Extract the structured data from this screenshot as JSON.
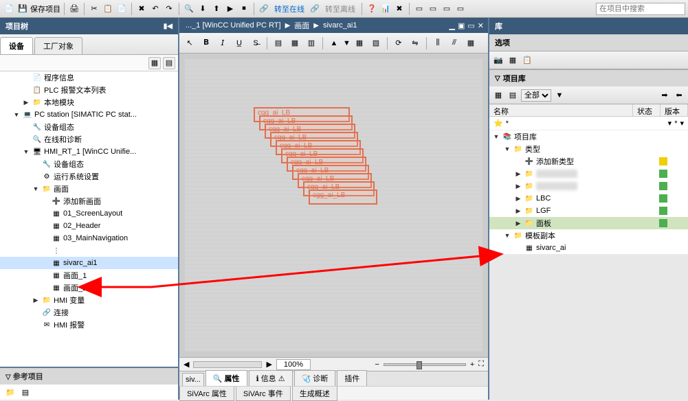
{
  "toolbar": {
    "save_project": "保存项目",
    "goto_online": "转至在线",
    "goto_offline": "转至离线",
    "search_placeholder": "在项目中搜索"
  },
  "left": {
    "title": "项目树",
    "tab_devices": "设备",
    "tab_plant": "工厂对象",
    "ref_title": "参考项目",
    "tree": [
      {
        "ind": 2,
        "arr": "",
        "ico": "📄",
        "label": "程序信息"
      },
      {
        "ind": 2,
        "arr": "",
        "ico": "📋",
        "label": "PLC 报警文本列表"
      },
      {
        "ind": 2,
        "arr": "▶",
        "ico": "📁",
        "label": "本地模块"
      },
      {
        "ind": 1,
        "arr": "▼",
        "ico": "💻",
        "label": "PC station [SIMATIC PC stat..."
      },
      {
        "ind": 2,
        "arr": "",
        "ico": "🔧",
        "label": "设备组态"
      },
      {
        "ind": 2,
        "arr": "",
        "ico": "🔍",
        "label": "在线和诊断"
      },
      {
        "ind": 2,
        "arr": "▼",
        "ico": "🖥",
        "label": "HMI_RT_1 [WinCC Unifie..."
      },
      {
        "ind": 3,
        "arr": "",
        "ico": "🔧",
        "label": "设备组态"
      },
      {
        "ind": 3,
        "arr": "",
        "ico": "⚙",
        "label": "运行系统设置"
      },
      {
        "ind": 3,
        "arr": "▼",
        "ico": "📁",
        "label": "画面"
      },
      {
        "ind": 4,
        "arr": "",
        "ico": "➕",
        "label": "添加新画面"
      },
      {
        "ind": 4,
        "arr": "",
        "ico": "▦",
        "label": "01_ScreenLayout"
      },
      {
        "ind": 4,
        "arr": "",
        "ico": "▦",
        "label": "02_Header"
      },
      {
        "ind": 4,
        "arr": "",
        "ico": "▦",
        "label": "03_MainNavigation"
      },
      {
        "ind": 4,
        "arr": "",
        "ico": "⋮",
        "label": ""
      },
      {
        "ind": 4,
        "arr": "",
        "ico": "▦",
        "label": "sivarc_ai1",
        "sel": true
      },
      {
        "ind": 4,
        "arr": "",
        "ico": "▦",
        "label": "画面_1"
      },
      {
        "ind": 4,
        "arr": "",
        "ico": "▦",
        "label": "画面_2"
      },
      {
        "ind": 3,
        "arr": "▶",
        "ico": "📁",
        "label": "HMI 变量"
      },
      {
        "ind": 3,
        "arr": "",
        "ico": "🔗",
        "label": "连接"
      },
      {
        "ind": 3,
        "arr": "",
        "ico": "✉",
        "label": "HMI 报警"
      }
    ]
  },
  "center": {
    "crumb1": "..._1 [WinCC Unified PC RT]",
    "crumb2": "画面",
    "crumb3": "sivarc_ai1",
    "zoom": "100%",
    "fp_label": "cgg_ai_LB",
    "bottom_tabs": {
      "siv": "siv...",
      "prop": "属性",
      "info": "信息",
      "diag": "诊断",
      "plugin": "插件"
    },
    "sivarc_tabs": {
      "attr": "SiVArc 属性",
      "event": "SiVArc 事件",
      "gen": "生成概述"
    }
  },
  "right": {
    "title": "库",
    "options": "选项",
    "proj_lib": "项目库",
    "filter_all": "全部",
    "col_name": "名称",
    "col_state": "状态",
    "col_ver": "版本",
    "filter_star": "*",
    "tree": [
      {
        "ind": 0,
        "arr": "▼",
        "ico": "📚",
        "label": "项目库"
      },
      {
        "ind": 1,
        "arr": "▼",
        "ico": "📁",
        "label": "类型"
      },
      {
        "ind": 2,
        "arr": "",
        "ico": "➕",
        "label": "添加新类型",
        "sq": "sq-yellow"
      },
      {
        "ind": 2,
        "arr": "▶",
        "ico": "📁",
        "label": "",
        "blur": true,
        "sq": "sq-green"
      },
      {
        "ind": 2,
        "arr": "▶",
        "ico": "📁",
        "label": "",
        "blur": true,
        "sq": "sq-green"
      },
      {
        "ind": 2,
        "arr": "▶",
        "ico": "📁",
        "label": "LBC",
        "sq": "sq-green"
      },
      {
        "ind": 2,
        "arr": "▶",
        "ico": "📁",
        "label": "LGF",
        "sq": "sq-green"
      },
      {
        "ind": 2,
        "arr": "▶",
        "ico": "📁",
        "label": "面板",
        "sq": "sq-green",
        "sel": true
      },
      {
        "ind": 1,
        "arr": "▼",
        "ico": "📁",
        "label": "模板副本"
      },
      {
        "ind": 2,
        "arr": "",
        "ico": "▦",
        "label": "sivarc_ai"
      }
    ]
  }
}
